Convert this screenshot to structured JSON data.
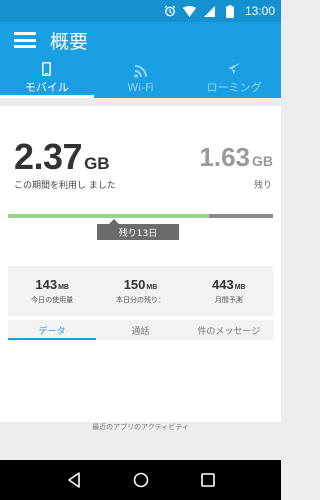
{
  "status": {
    "time": "13:00"
  },
  "app": {
    "title": "概要"
  },
  "tabs": [
    {
      "label": "モバイル",
      "icon": "phone-icon",
      "active": true
    },
    {
      "label": "Wi-Fi",
      "icon": "wifi-icon",
      "active": false
    },
    {
      "label": "ローミング",
      "icon": "airplane-icon",
      "active": false
    }
  ],
  "usage": {
    "used_value": "2.37",
    "used_unit": "GB",
    "used_caption": "この期間を利用し ました",
    "remaining_value": "1.63",
    "remaining_unit": "GB",
    "remaining_caption": "残り",
    "used_fraction": 0.76,
    "days_remaining": "残り13日"
  },
  "stats": [
    {
      "value": "143",
      "unit": "MB",
      "label": "今日の使用量"
    },
    {
      "value": "150",
      "unit": "MB",
      "label": "本日分の残り："
    },
    {
      "value": "443",
      "unit": "MB",
      "label": "月間予測"
    }
  ],
  "sub_tabs": [
    {
      "label": "データ",
      "active": true
    },
    {
      "label": "通話",
      "active": false
    },
    {
      "label": "件のメッセージ",
      "active": false
    }
  ],
  "footer": {
    "label": "最近のアプリのアクティビティ"
  },
  "colors": {
    "primary": "#1aa0e2",
    "status": "#1591cf",
    "fill": "#9ad68a"
  }
}
